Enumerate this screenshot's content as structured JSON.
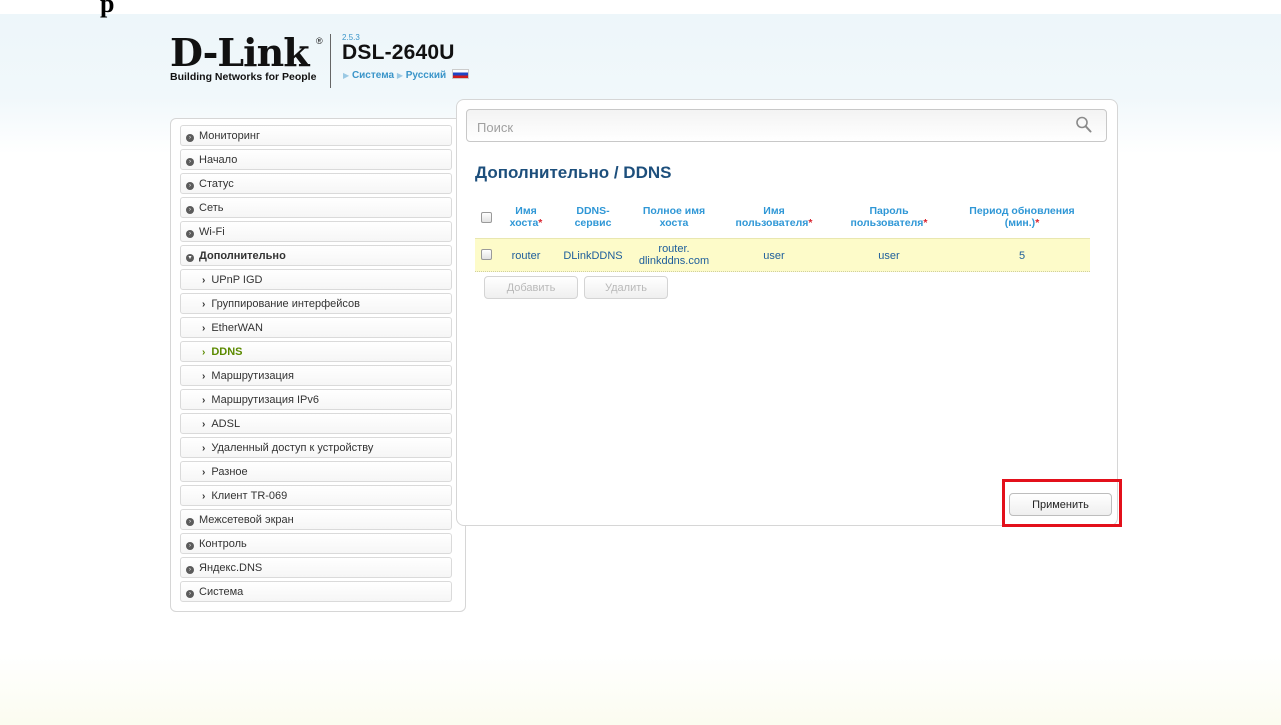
{
  "header": {
    "top_fragment": "p",
    "logo_text": "D-Link",
    "logo_registered": "®",
    "logo_tagline": "Building Networks for People",
    "firmware_version": "2.5.3",
    "model": "DSL-2640U",
    "breadcrumb_system": "Система",
    "breadcrumb_language": "Русский"
  },
  "search": {
    "placeholder": "Поиск"
  },
  "sidebar": {
    "items": [
      {
        "label": "Мониторинг"
      },
      {
        "label": "Начало"
      },
      {
        "label": "Статус"
      },
      {
        "label": "Сеть"
      },
      {
        "label": "Wi-Fi"
      },
      {
        "label": "Дополнительно",
        "expanded": true
      },
      {
        "label": "UPnP IGD",
        "sub": true
      },
      {
        "label": "Группирование интерфейсов",
        "sub": true
      },
      {
        "label": "EtherWAN",
        "sub": true
      },
      {
        "label": "DDNS",
        "sub": true,
        "active": true
      },
      {
        "label": "Маршрутизация",
        "sub": true
      },
      {
        "label": "Маршрутизация IPv6",
        "sub": true
      },
      {
        "label": "ADSL",
        "sub": true
      },
      {
        "label": "Удаленный доступ к устройству",
        "sub": true
      },
      {
        "label": "Разное",
        "sub": true
      },
      {
        "label": "Клиент TR-069",
        "sub": true
      },
      {
        "label": "Межсетевой экран"
      },
      {
        "label": "Контроль"
      },
      {
        "label": "Яндекс.DNS"
      },
      {
        "label": "Система"
      }
    ]
  },
  "main": {
    "title": "Дополнительно /  DDNS",
    "table": {
      "headers": [
        {
          "line1": "Имя",
          "line2": "хоста",
          "required": true
        },
        {
          "line1": "DDNS-",
          "line2": "сервис",
          "required": false
        },
        {
          "line1": "Полное имя",
          "line2": "хоста",
          "required": false
        },
        {
          "line1": "Имя",
          "line2": "пользователя",
          "required": true
        },
        {
          "line1": "Пароль",
          "line2": "пользователя",
          "required": true
        },
        {
          "line1": "Период обновления",
          "line2": "(мин.)",
          "required": true
        }
      ],
      "required_mark": "*",
      "rows": [
        {
          "host": "router",
          "service": "DLinkDDNS",
          "fqdn_line1": "router.",
          "fqdn_line2": "dlinkddns.com",
          "user": "user",
          "password": "user",
          "period": "5",
          "checked": false
        }
      ]
    },
    "add_label": "Добавить",
    "delete_label": "Удалить",
    "apply_label": "Применить"
  },
  "colors": {
    "accent": "#2f97d6",
    "title": "#1d4f7c",
    "active_menu": "#5b8a00",
    "row_highlight": "#fdfbc9",
    "annotation_box": "#e3101b"
  }
}
